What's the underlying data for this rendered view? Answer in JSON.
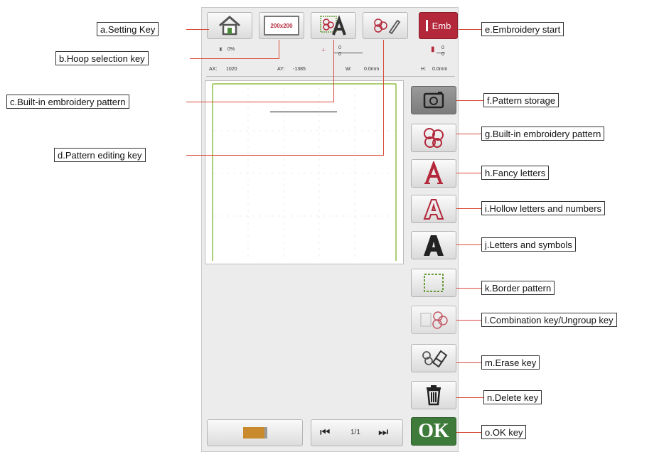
{
  "toolbar": {
    "hoop_size": "200x200",
    "emb_label": "Emb"
  },
  "info_row1": {
    "zoom": "0%",
    "stitch_top": "0",
    "stitch_bottom": "0",
    "color_top": "0",
    "color_bottom": "0"
  },
  "info_row2": {
    "ax_label": "AX:",
    "ax_value": "1020",
    "ay_label": "AY:",
    "ay_value": "-1385",
    "w_label": "W:",
    "w_value": "0.0mm",
    "h_label": "H:",
    "h_value": "0.0mm"
  },
  "pager": {
    "page": "1/1"
  },
  "ok_label": "OK",
  "callouts": {
    "a": "a.Setting Key",
    "b": "b.Hoop selection key",
    "c": "c.Built-in embroidery pattern",
    "d": "d.Pattern editing key",
    "e": "e.Embroidery start",
    "f": "f.Pattern storage",
    "g": "g.Built-in embroidery pattern",
    "h": "h.Fancy letters",
    "i": "i.Hollow letters and numbers",
    "j": "j.Letters and symbols",
    "k": "k.Border pattern",
    "l": "l.Combination key/Ungroup key",
    "m": "m.Erase key",
    "n": "n.Delete key",
    "o": "o.OK key"
  },
  "colors": {
    "accent_red": "#b3283a",
    "ok_green": "#3e7b3a",
    "leader_red": "#d94a3a",
    "canvas_green": "#8fbf4a",
    "battery_orange": "#c98a2e"
  }
}
